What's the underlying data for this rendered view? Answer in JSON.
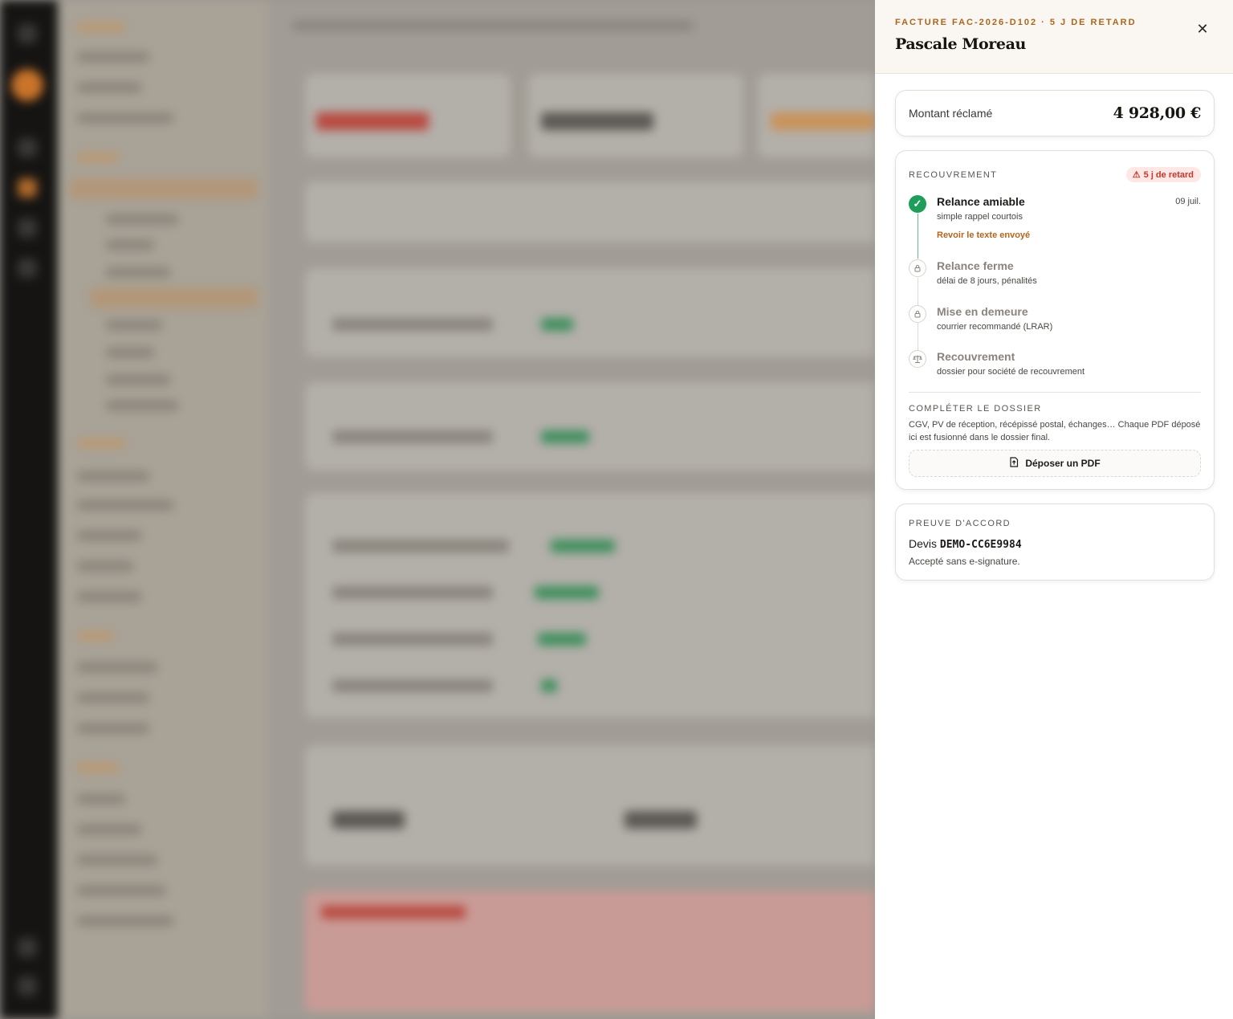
{
  "drawer": {
    "eyebrow": "FACTURE FAC-2026-D102 · 5 J DE RETARD",
    "title": "Pascale Moreau",
    "close_icon": "close-icon"
  },
  "amount": {
    "label": "Montant réclamé",
    "value": "4 928,00 €"
  },
  "recovery": {
    "heading": "RECOUVREMENT",
    "badge": "5 j de retard",
    "badge_icon": "warning-icon",
    "steps": [
      {
        "title": "Relance amiable",
        "subtitle": "simple rappel courtois",
        "link": "Revoir le texte envoyé",
        "date": "09 juil.",
        "state": "done",
        "icon": "check-icon"
      },
      {
        "title": "Relance ferme",
        "subtitle": "délai de 8 jours, pénalités",
        "state": "locked",
        "icon": "lock-icon"
      },
      {
        "title": "Mise en demeure",
        "subtitle": "courrier recommandé (LRAR)",
        "state": "locked",
        "icon": "lock-icon"
      },
      {
        "title": "Recouvrement",
        "subtitle": "dossier pour société de recouvrement",
        "state": "locked",
        "icon": "scales-icon"
      }
    ],
    "complete_heading": "COMPLÉTER LE DOSSIER",
    "complete_text": "CGV, PV de réception, récépissé postal, échanges… Chaque PDF déposé ici est fusionné dans le dossier final.",
    "upload_label": "Déposer un PDF",
    "upload_icon": "file-upload-icon"
  },
  "proof": {
    "heading": "PREUVE D'ACCORD",
    "prefix": "Devis",
    "code": "DEMO-CC6E9984",
    "note": "Accepté sans e-signature."
  },
  "colors": {
    "accent": "#a8661f",
    "success": "#1f9d5a",
    "danger": "#c8352a"
  }
}
